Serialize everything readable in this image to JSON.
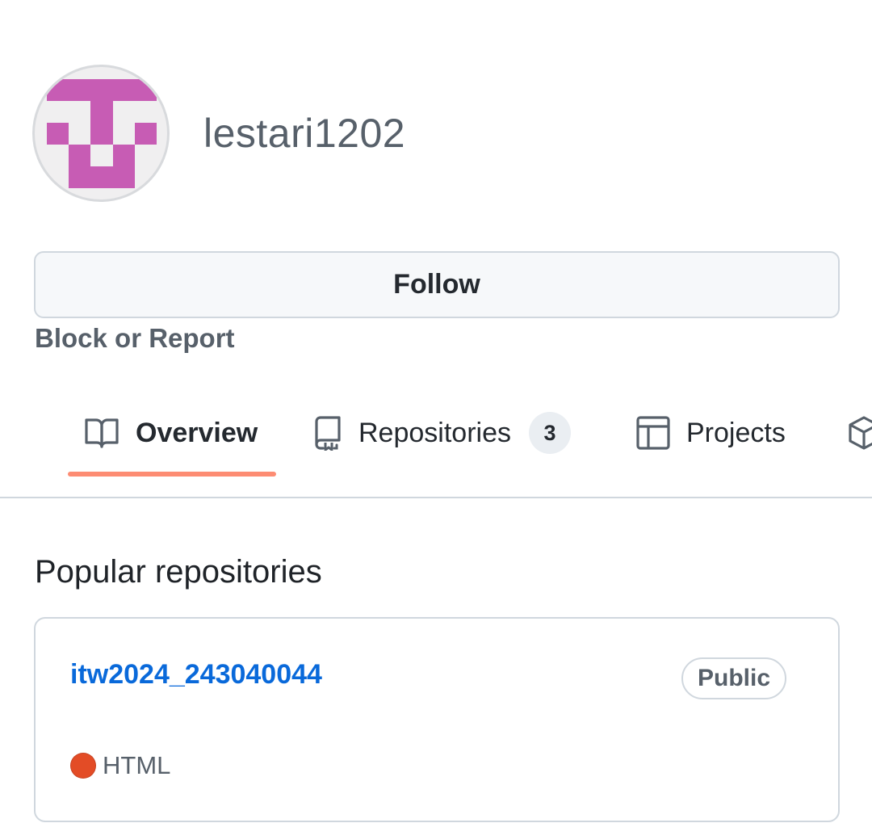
{
  "profile": {
    "username": "lestari1202",
    "avatar_color": "#c75cb4"
  },
  "actions": {
    "follow_label": "Follow",
    "block_label": "Block or Report"
  },
  "tabs": [
    {
      "label": "Overview",
      "icon": "book-icon",
      "active": true
    },
    {
      "label": "Repositories",
      "icon": "repo-icon",
      "count": "3"
    },
    {
      "label": "Projects",
      "icon": "table-icon"
    },
    {
      "label": "",
      "icon": "package-icon"
    }
  ],
  "section": {
    "title": "Popular repositories"
  },
  "repos": [
    {
      "name": "itw2024_243040044",
      "visibility": "Public",
      "language": "HTML",
      "language_color": "#e34c26"
    }
  ],
  "colors": {
    "accent_underline": "#fd8c73",
    "link": "#0969da"
  }
}
